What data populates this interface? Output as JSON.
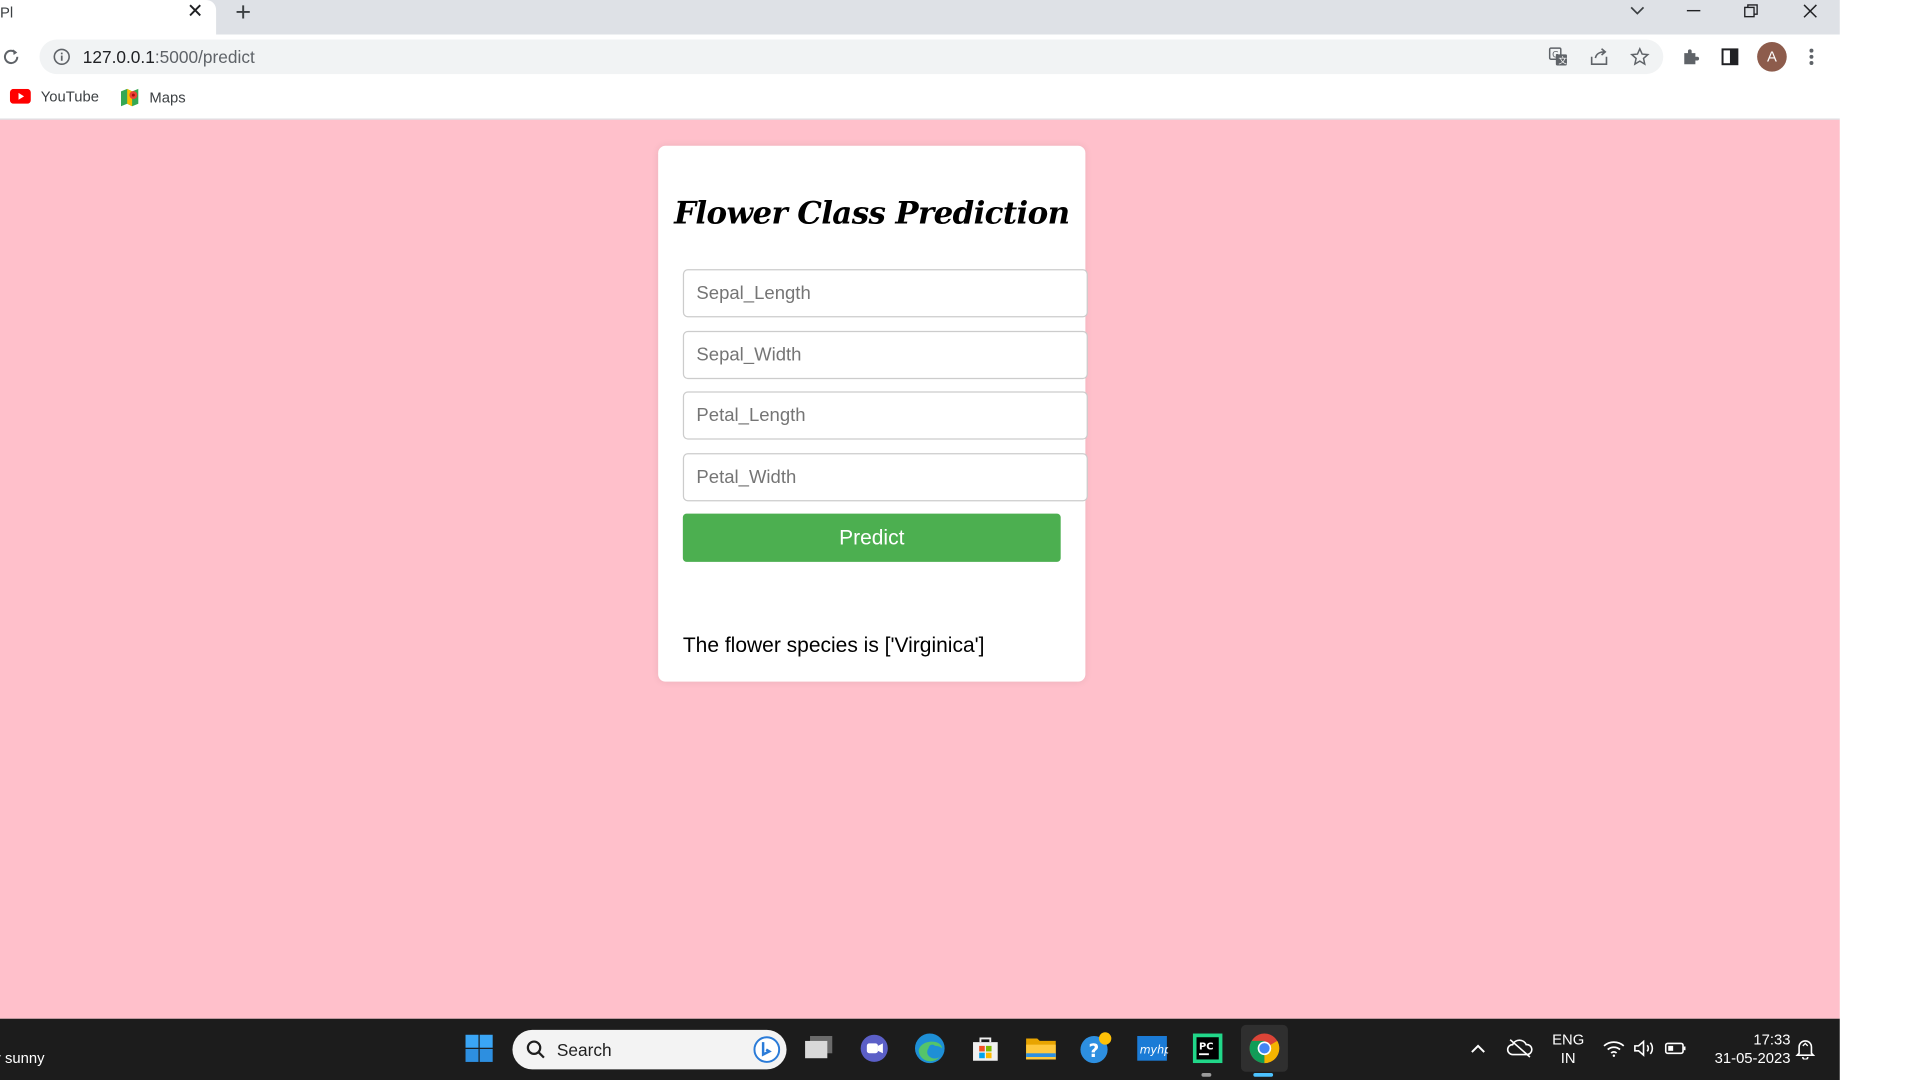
{
  "browser": {
    "tab_title": "Pl",
    "url_host": "127.0.0.1",
    "url_path": ":5000/predict",
    "bookmarks": [
      {
        "label": "YouTube",
        "icon": "youtube-icon"
      },
      {
        "label": "Maps",
        "icon": "maps-icon"
      }
    ],
    "profile_initial": "A"
  },
  "page": {
    "background": "#ffc0cb",
    "title": "Flower Class Prediction",
    "fields": [
      {
        "placeholder": "Sepal_Length",
        "value": ""
      },
      {
        "placeholder": "Sepal_Width",
        "value": ""
      },
      {
        "placeholder": "Petal_Length",
        "value": ""
      },
      {
        "placeholder": "Petal_Width",
        "value": ""
      }
    ],
    "predict_label": "Predict",
    "predict_color": "#4caf50",
    "result_text": "The flower species is ['Virginica']"
  },
  "taskbar": {
    "weather_text": "ly sunny",
    "search_label": "Search",
    "lang_top": "ENG",
    "lang_bottom": "IN",
    "time": "17:33",
    "date": "31-05-2023",
    "apps": [
      "windows-start-icon",
      "task-view-icon",
      "teams-chat-icon",
      "edge-icon",
      "store-icon",
      "file-explorer-icon",
      "help-icon",
      "myhp-icon",
      "pycharm-icon",
      "chrome-icon"
    ]
  }
}
